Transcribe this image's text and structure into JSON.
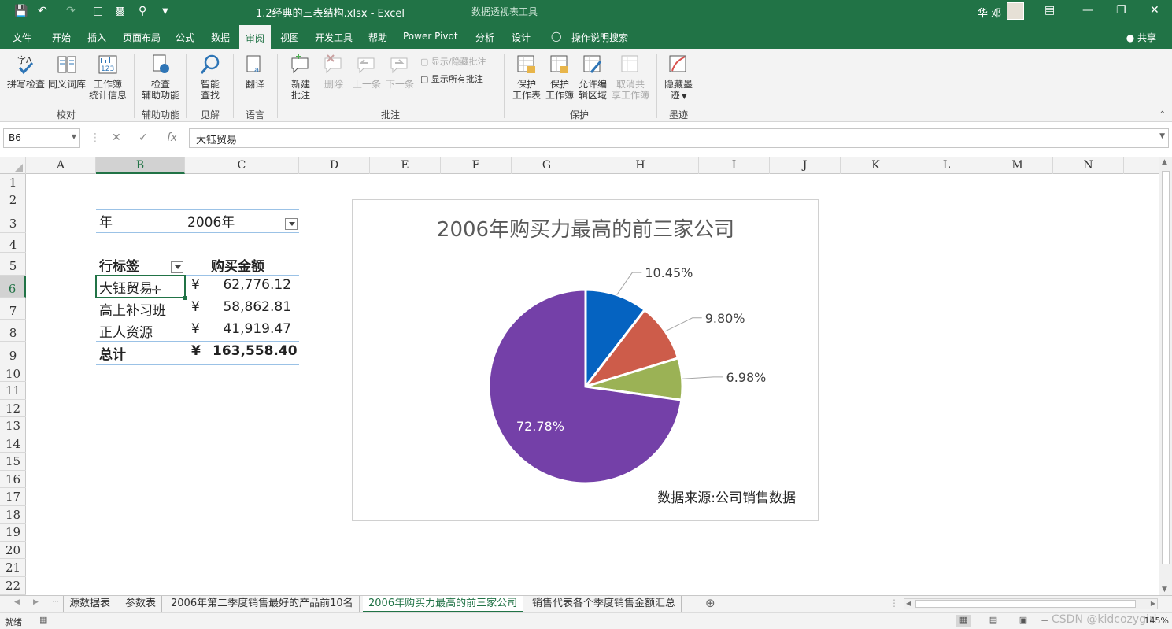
{
  "titlebar": {
    "filename": "1.2经典的三表结构.xlsx  -  Excel",
    "context_tool": "数据透视表工具",
    "user": "华 邓"
  },
  "tabs": [
    {
      "label": "文件"
    },
    {
      "label": "开始"
    },
    {
      "label": "插入"
    },
    {
      "label": "页面布局"
    },
    {
      "label": "公式"
    },
    {
      "label": "数据"
    },
    {
      "label": "审阅"
    },
    {
      "label": "视图"
    },
    {
      "label": "开发工具"
    },
    {
      "label": "帮助"
    },
    {
      "label": "Power Pivot"
    },
    {
      "label": "分析"
    },
    {
      "label": "设计"
    },
    {
      "label": "操作说明搜索"
    }
  ],
  "active_tab": "审阅",
  "share_label": "共享",
  "ribbon": {
    "proofing": {
      "spell": "拼写检查",
      "thesaurus": "同义词库",
      "stats_l1": "工作簿",
      "stats_l2": "统计信息",
      "group": "校对"
    },
    "access": {
      "l1": "检查",
      "l2": "辅助功能",
      "group": "辅助功能"
    },
    "insights": {
      "l1": "智能",
      "l2": "查找",
      "group": "见解"
    },
    "language": {
      "translate": "翻译",
      "group": "语言"
    },
    "comments": {
      "new_l1": "新建",
      "new_l2": "批注",
      "delete": "删除",
      "prev": "上一条",
      "next": "下一条",
      "show_hide": "显示/隐藏批注",
      "show_all": "显示所有批注",
      "group": "批注"
    },
    "protect": {
      "sheet_l1": "保护",
      "sheet_l2": "工作表",
      "book_l1": "保护",
      "book_l2": "工作簿",
      "ranges_l1": "允许编",
      "ranges_l2": "辑区域",
      "unshare_l1": "取消共",
      "unshare_l2": "享工作簿",
      "group": "保护"
    },
    "ink": {
      "l1": "隐藏墨",
      "l2": "迹",
      "group": "墨迹"
    }
  },
  "formula_bar": {
    "namebox": "B6",
    "formula": "大钰贸易",
    "fx": "fx"
  },
  "columns": [
    "A",
    "B",
    "C",
    "D",
    "E",
    "F",
    "G",
    "H",
    "I",
    "J",
    "K",
    "L",
    "M",
    "N"
  ],
  "selected_column": "B",
  "rows": [
    "1",
    "2",
    "3",
    "4",
    "5",
    "6",
    "7",
    "8",
    "9",
    "10",
    "11",
    "12",
    "13",
    "14",
    "15",
    "16",
    "17",
    "18",
    "19",
    "20",
    "21",
    "22"
  ],
  "selected_row": "6",
  "pivot": {
    "filter_label": "年",
    "filter_value": "2006年",
    "row_label_header": "行标签",
    "value_header": "购买金额",
    "currency": "¥",
    "rows": [
      {
        "name": "大钰贸易",
        "amount": "62,776.12"
      },
      {
        "name": "高上补习班",
        "amount": "58,862.81"
      },
      {
        "name": "正人资源",
        "amount": "41,919.47"
      }
    ],
    "total_label": "总计",
    "total_amount": "163,558.40"
  },
  "chart_data": {
    "type": "pie",
    "title": "2006年购买力最高的前三家公司",
    "annotation": "数据来源:公司销售数据",
    "slices": [
      {
        "value": 10.45,
        "label": "10.45%",
        "color": "#0563C1"
      },
      {
        "value": 9.8,
        "label": "9.80%",
        "color": "#CD5C4A"
      },
      {
        "value": 6.98,
        "label": "6.98%",
        "color": "#9BB255"
      },
      {
        "value": 72.78,
        "label": "72.78%",
        "color": "#7440A8"
      }
    ]
  },
  "sheet_tabs": [
    {
      "label": "源数据表"
    },
    {
      "label": "参数表"
    },
    {
      "label": "2006年第二季度销售最好的产品前10名"
    },
    {
      "label": "2006年购买力最高的前三家公司"
    },
    {
      "label": "销售代表各个季度销售金额汇总"
    }
  ],
  "active_sheet": "2006年购买力最高的前三家公司",
  "status": {
    "ready": "就绪",
    "zoom": "145%",
    "watermark": "CSDN @kidcozygirl"
  }
}
